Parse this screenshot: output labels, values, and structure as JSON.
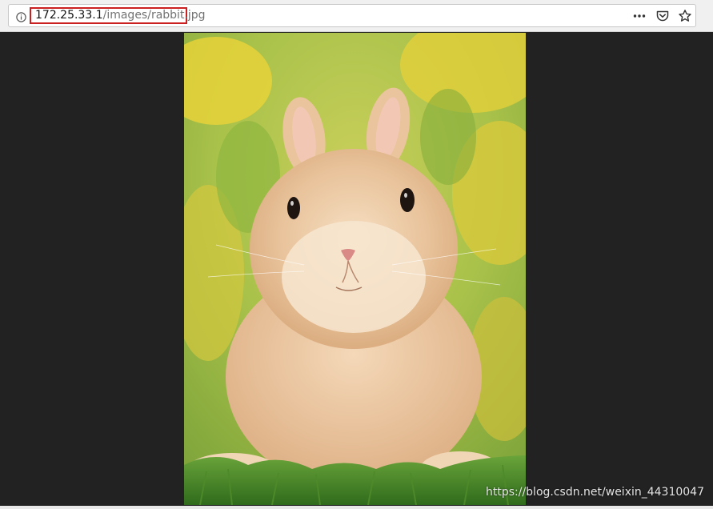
{
  "address_bar": {
    "url_host": "172.25.33.1",
    "url_path": "/images/rabbit.jpg",
    "highlight_color": "#cc1f1f",
    "site_info_icon": "info-circle-icon"
  },
  "toolbar_icons": [
    "more-options-icon",
    "pocket-icon",
    "bookmark-star-icon"
  ],
  "viewer": {
    "background": "#222222",
    "image_subject": "rabbit photo"
  },
  "watermark": {
    "text": "https://blog.csdn.net/weixin_44310047"
  }
}
